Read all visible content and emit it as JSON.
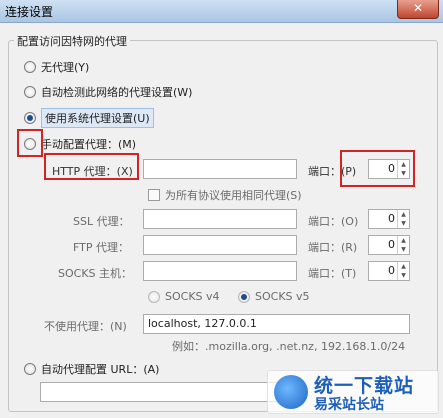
{
  "window": {
    "title": "连接设置",
    "close": "✕"
  },
  "group": {
    "label": "配置访问因特网的代理"
  },
  "options": {
    "no_proxy": "无代理(Y)",
    "auto_detect": "自动检测此网络的代理设置(W)",
    "system_proxy": "使用系统代理设置(U)",
    "manual": "手动配置代理：(M)"
  },
  "http": {
    "label": "HTTP 代理：(X)",
    "value": "",
    "port_label": "端口：(P)",
    "port": "0"
  },
  "same_proxy": "为所有协议使用相同代理(S)",
  "ssl": {
    "label": "SSL 代理：",
    "value": "",
    "port_label": "端口：(O)",
    "port": "0"
  },
  "ftp": {
    "label": "FTP 代理：",
    "value": "",
    "port_label": "端口：(R)",
    "port": "0"
  },
  "socks": {
    "label": "SOCKS 主机：",
    "value": "",
    "port_label": "端口：(T)",
    "port": "0",
    "v4": "SOCKS v4",
    "v5": "SOCKS v5"
  },
  "no_proxy_for": {
    "label": "不使用代理：(N)",
    "value": "localhost, 127.0.0.1",
    "example": "例如：.mozilla.org, .net.nz, 192.168.1.0/24"
  },
  "auto_url": {
    "label": "自动代理配置 URL：(A)",
    "value": ""
  },
  "watermark": {
    "line1": "统一下载站",
    "line2": "易采站长站"
  },
  "colors": {
    "highlight": "#d22424",
    "accent": "#1e4d8f"
  }
}
